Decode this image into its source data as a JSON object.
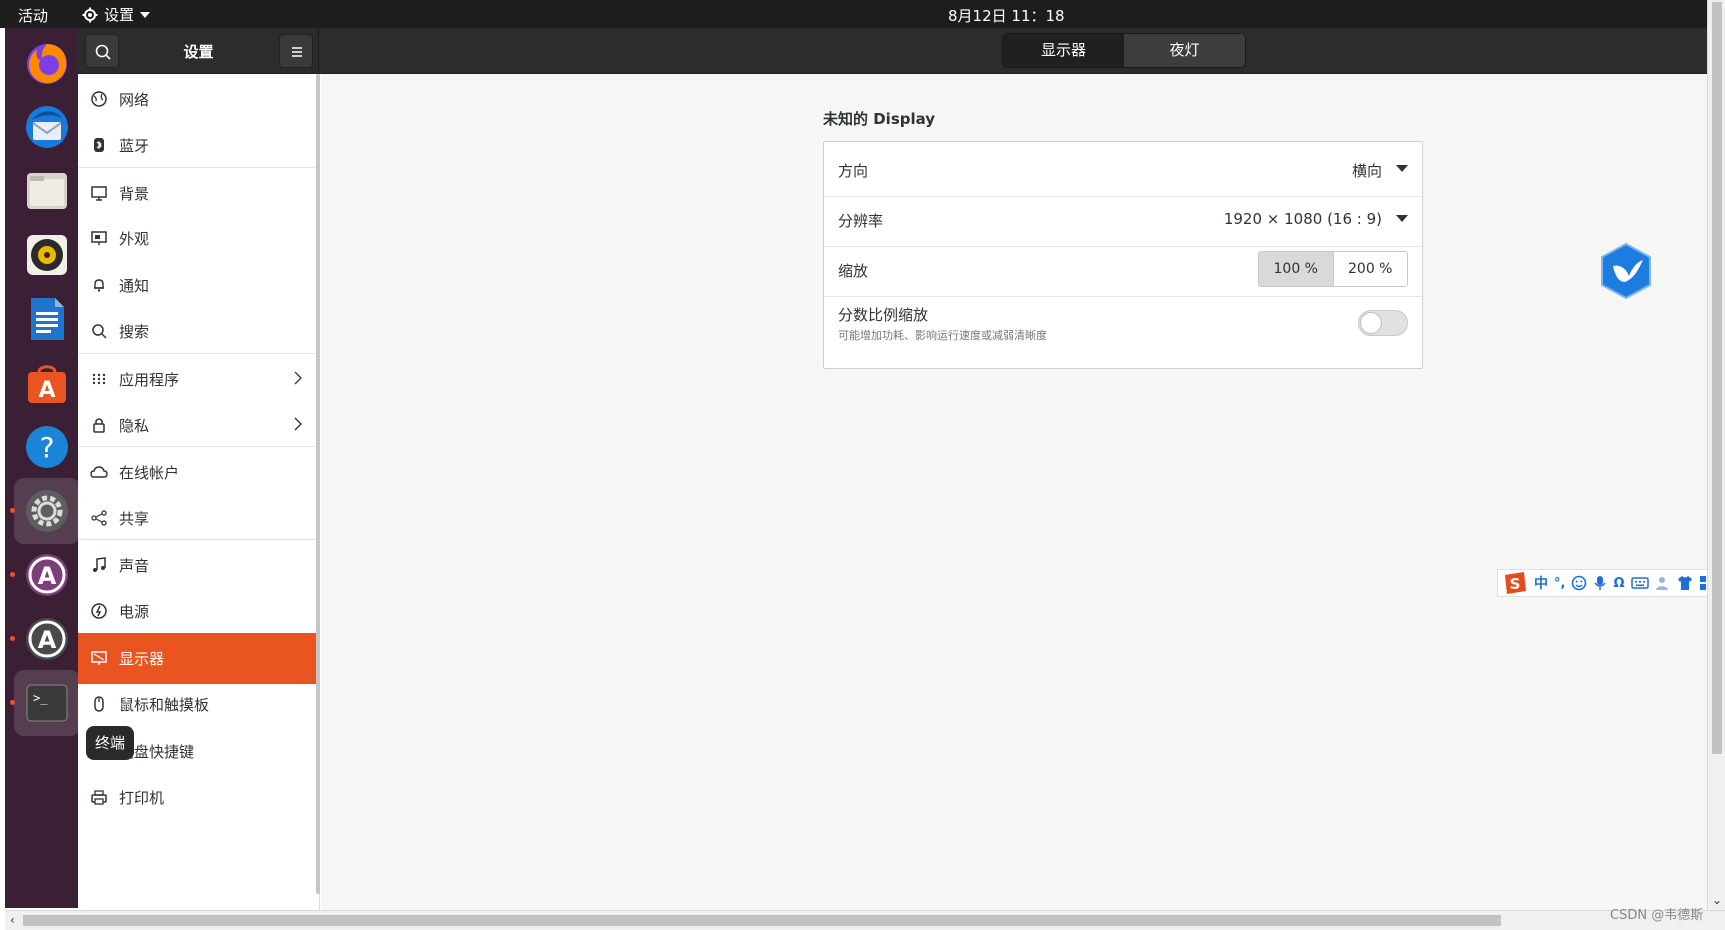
{
  "topbar": {
    "activities": "活动",
    "app_menu": "设置",
    "clock": "8月12日  11：18"
  },
  "dock": {
    "items": [
      {
        "name": "firefox-icon",
        "running": false
      },
      {
        "name": "thunderbird-icon",
        "running": false
      },
      {
        "name": "files-icon",
        "running": false
      },
      {
        "name": "rhythmbox-icon",
        "running": false
      },
      {
        "name": "libreoffice-writer-icon",
        "running": false
      },
      {
        "name": "software-center-icon",
        "running": false
      },
      {
        "name": "help-icon",
        "running": false
      },
      {
        "name": "settings-icon",
        "running": true
      },
      {
        "name": "software-updater-icon",
        "running": true
      },
      {
        "name": "software-updater-2-icon",
        "running": true
      },
      {
        "name": "terminal-icon",
        "running": true
      }
    ],
    "tooltip": "终端"
  },
  "header": {
    "sidebar_title": "设置",
    "tabs": [
      "显示器",
      "夜灯"
    ],
    "active_tab": 0
  },
  "sidebar": {
    "items": [
      {
        "label": "网络",
        "icon": "network-icon"
      },
      {
        "label": "蓝牙",
        "icon": "bluetooth-icon"
      },
      {
        "label": "背景",
        "icon": "background-icon"
      },
      {
        "label": "外观",
        "icon": "appearance-icon"
      },
      {
        "label": "通知",
        "icon": "notification-bell-icon"
      },
      {
        "label": "搜索",
        "icon": "search-icon"
      },
      {
        "label": "应用程序",
        "icon": "apps-grid-icon",
        "arrow": true
      },
      {
        "label": "隐私",
        "icon": "lock-icon",
        "arrow": true
      },
      {
        "label": "在线帐户",
        "icon": "cloud-icon"
      },
      {
        "label": "共享",
        "icon": "share-icon"
      },
      {
        "label": "声音",
        "icon": "music-note-icon"
      },
      {
        "label": "电源",
        "icon": "power-icon"
      },
      {
        "label": "显示器",
        "icon": "display-icon",
        "selected": true
      },
      {
        "label": "鼠标和触摸板",
        "icon": "mouse-icon"
      },
      {
        "label": "键盘快捷键",
        "icon": "keyboard-icon"
      },
      {
        "label": "打印机",
        "icon": "printer-icon"
      }
    ]
  },
  "display": {
    "title": "未知的 Display",
    "orientation_label": "方向",
    "orientation_value": "横向",
    "resolution_label": "分辨率",
    "resolution_value": "1920 × 1080 (16 : 9)",
    "scale_label": "缩放",
    "scale_options": [
      "100 %",
      "200 %"
    ],
    "scale_selected": "100 %",
    "fractional_label": "分数比例缩放",
    "fractional_sub": "可能增加功耗、影响运行速度或减弱清晰度",
    "fractional_enabled": false
  },
  "ime": {
    "mode": "中"
  },
  "watermark": "CSDN @韦德斯",
  "colors": {
    "accent": "#e95420",
    "topbar": "#1d1d1d",
    "dock": "#3b1f35",
    "headerbar": "#2c2c2c"
  }
}
